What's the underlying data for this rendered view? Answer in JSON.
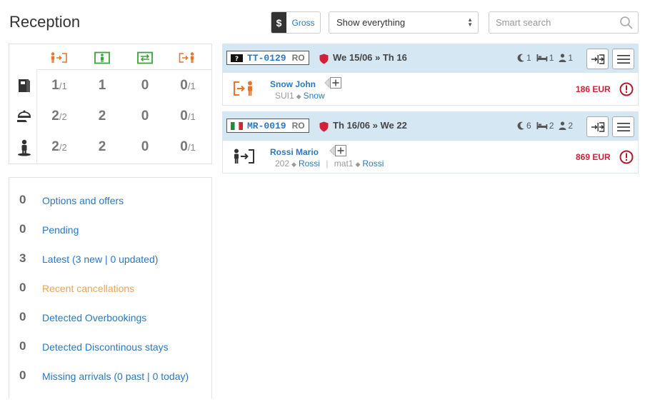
{
  "header": {
    "title": "Reception",
    "gross_symbol": "$",
    "gross_label": "Gross",
    "filter_value": "Show everything",
    "search_placeholder": "Smart search"
  },
  "colors": {
    "link": "#2a78c2",
    "arrival": "#e8732a",
    "inhouse": "#3aa33a",
    "move": "#3aa33a",
    "departure": "#e8732a",
    "amount": "#d0213a",
    "header_band": "#d6e7f4"
  },
  "stats": {
    "columns": [
      {
        "icon": "arrival-icon"
      },
      {
        "icon": "in-house-icon"
      },
      {
        "icon": "room-move-icon"
      },
      {
        "icon": "departure-icon"
      }
    ],
    "rows": [
      {
        "icon": "room-icon",
        "cells": [
          {
            "main": "1",
            "sub": "/1"
          },
          {
            "main": "1",
            "sub": ""
          },
          {
            "main": "0",
            "sub": ""
          },
          {
            "main": "0",
            "sub": "/1"
          }
        ]
      },
      {
        "icon": "meal-service-icon",
        "cells": [
          {
            "main": "2",
            "sub": "/2"
          },
          {
            "main": "2",
            "sub": ""
          },
          {
            "main": "0",
            "sub": ""
          },
          {
            "main": "0",
            "sub": "/1"
          }
        ]
      },
      {
        "icon": "guest-icon",
        "cells": [
          {
            "main": "2",
            "sub": "/2"
          },
          {
            "main": "2",
            "sub": ""
          },
          {
            "main": "0",
            "sub": ""
          },
          {
            "main": "0",
            "sub": "/1"
          }
        ]
      }
    ]
  },
  "counters": [
    {
      "count": "0",
      "label": "Options and offers"
    },
    {
      "count": "0",
      "label": "Pending"
    },
    {
      "count": "3",
      "label": "Latest (3 new | 0 updated)"
    },
    {
      "count": "0",
      "label": "Recent cancellations"
    },
    {
      "count": "0",
      "label": "Detected Overbookings"
    },
    {
      "count": "0",
      "label": "Detected Discontinous stays"
    },
    {
      "count": "0",
      "label": "Missing arrivals (0 past | 0 today)"
    }
  ],
  "bookings": [
    {
      "flag": "unknown-flag-icon",
      "code": "TT-0129",
      "board": "RO",
      "dates": "We 15/06 » Th 16",
      "nights": "1",
      "beds": "1",
      "guests": "1",
      "status_icon": "departure-icon",
      "guest_name": "Snow John",
      "room": "SUI1",
      "room_guest": "Snow",
      "amount": "186 EUR"
    },
    {
      "flag": "italy-flag-icon",
      "code": "MR-0019",
      "board": "RO",
      "dates": "Th 16/06 » We 22",
      "nights": "6",
      "beds": "2",
      "guests": "2",
      "status_icon": "arrival-icon",
      "guest_name": "Rossi Mario",
      "room": "202",
      "room_guest": "Rossi",
      "room2": "mat1",
      "room2_guest": "Rossi",
      "amount": "869 EUR"
    }
  ]
}
